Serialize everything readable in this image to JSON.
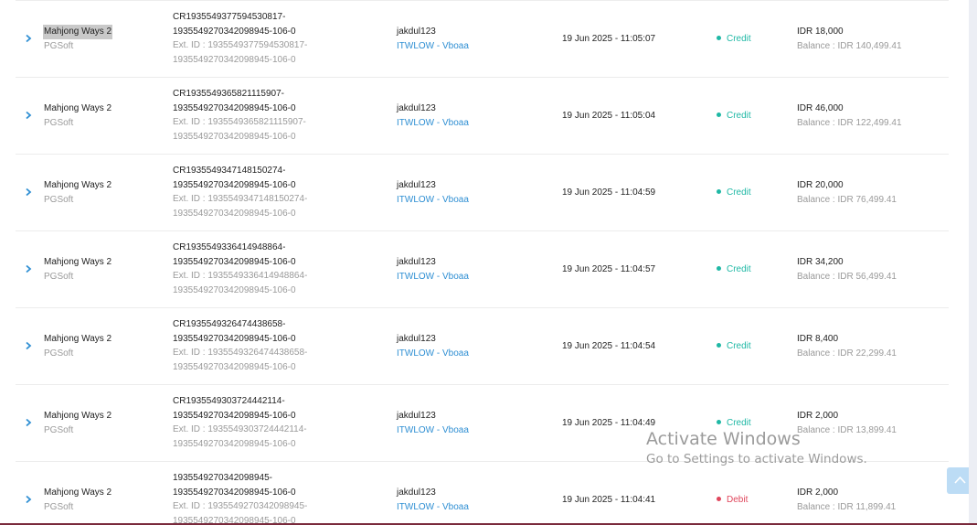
{
  "rows": [
    {
      "game": "Mahjong Ways 2",
      "provider": "PGSoft",
      "txn_line1": "CR1935549377594530817-",
      "txn_line2": "1935549270342098945-106-0",
      "ext_line1": "Ext. ID : 1935549377594530817-",
      "ext_line2": "1935549270342098945-106-0",
      "user": "jakdul123",
      "agent": "ITWLOW - Vboaa",
      "time": "19 Jun 2025 - 11:05:07",
      "type": "Credit",
      "amount": "IDR 18,000",
      "balance": "Balance : IDR 140,499.41"
    },
    {
      "game": "Mahjong Ways 2",
      "provider": "PGSoft",
      "txn_line1": "CR1935549365821115907-",
      "txn_line2": "1935549270342098945-106-0",
      "ext_line1": "Ext. ID : 1935549365821115907-",
      "ext_line2": "1935549270342098945-106-0",
      "user": "jakdul123",
      "agent": "ITWLOW - Vboaa",
      "time": "19 Jun 2025 - 11:05:04",
      "type": "Credit",
      "amount": "IDR 46,000",
      "balance": "Balance : IDR 122,499.41"
    },
    {
      "game": "Mahjong Ways 2",
      "provider": "PGSoft",
      "txn_line1": "CR1935549347148150274-",
      "txn_line2": "1935549270342098945-106-0",
      "ext_line1": "Ext. ID : 1935549347148150274-",
      "ext_line2": "1935549270342098945-106-0",
      "user": "jakdul123",
      "agent": "ITWLOW - Vboaa",
      "time": "19 Jun 2025 - 11:04:59",
      "type": "Credit",
      "amount": "IDR 20,000",
      "balance": "Balance : IDR 76,499.41"
    },
    {
      "game": "Mahjong Ways 2",
      "provider": "PGSoft",
      "txn_line1": "CR1935549336414948864-",
      "txn_line2": "1935549270342098945-106-0",
      "ext_line1": "Ext. ID : 1935549336414948864-",
      "ext_line2": "1935549270342098945-106-0",
      "user": "jakdul123",
      "agent": "ITWLOW - Vboaa",
      "time": "19 Jun 2025 - 11:04:57",
      "type": "Credit",
      "amount": "IDR 34,200",
      "balance": "Balance : IDR 56,499.41"
    },
    {
      "game": "Mahjong Ways 2",
      "provider": "PGSoft",
      "txn_line1": "CR1935549326474438658-",
      "txn_line2": "1935549270342098945-106-0",
      "ext_line1": "Ext. ID : 1935549326474438658-",
      "ext_line2": "1935549270342098945-106-0",
      "user": "jakdul123",
      "agent": "ITWLOW - Vboaa",
      "time": "19 Jun 2025 - 11:04:54",
      "type": "Credit",
      "amount": "IDR 8,400",
      "balance": "Balance : IDR 22,299.41"
    },
    {
      "game": "Mahjong Ways 2",
      "provider": "PGSoft",
      "txn_line1": "CR1935549303724442114-",
      "txn_line2": "1935549270342098945-106-0",
      "ext_line1": "Ext. ID : 1935549303724442114-",
      "ext_line2": "1935549270342098945-106-0",
      "user": "jakdul123",
      "agent": "ITWLOW - Vboaa",
      "time": "19 Jun 2025 - 11:04:49",
      "type": "Credit",
      "amount": "IDR 2,000",
      "balance": "Balance : IDR 13,899.41"
    },
    {
      "game": "Mahjong Ways 2",
      "provider": "PGSoft",
      "txn_line1": "1935549270342098945-",
      "txn_line2": "1935549270342098945-106-0",
      "ext_line1": "Ext. ID : 1935549270342098945-",
      "ext_line2": "1935549270342098945-106-0",
      "user": "jakdul123",
      "agent": "ITWLOW - Vboaa",
      "time": "19 Jun 2025 - 11:04:41",
      "type": "Debit",
      "amount": "IDR 2,000",
      "balance": "Balance : IDR 11,899.41"
    }
  ],
  "watermark": {
    "title": "Activate Windows",
    "subtitle": "Go to Settings to activate Windows."
  },
  "colors": {
    "credit": "#1fb8a5",
    "debit": "#e0465c",
    "link": "#2f8fd3"
  },
  "icons": {
    "row_toggle": "chevron-right-icon",
    "scroll_top": "chevron-up-icon"
  }
}
